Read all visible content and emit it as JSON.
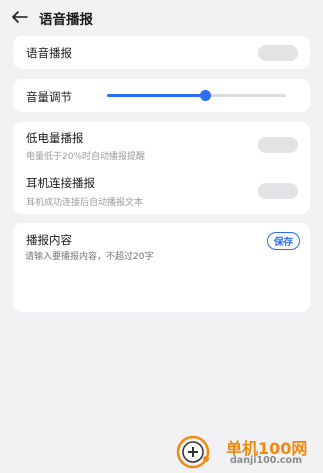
{
  "header": {
    "title": "语音播报"
  },
  "voice_broadcast": {
    "label": "语音播报",
    "enabled": false
  },
  "volume": {
    "label": "音量调节",
    "level": 0.55
  },
  "low_battery": {
    "label": "低电量播报",
    "description": "电量低于20%时自动播报提醒",
    "enabled": false
  },
  "earphone": {
    "label": "耳机连接播报",
    "description": "耳机成功连接后自动播报文本",
    "enabled": false
  },
  "broadcast_content": {
    "label": "播报内容",
    "save_label": "保存",
    "placeholder": "请输入要播报内容，不超过20字",
    "value": ""
  },
  "watermark": {
    "name": "单机100网",
    "url": "danji100.com"
  },
  "colors": {
    "accent": "#2a6ef2",
    "background": "#f2f2f4",
    "card": "#ffffff",
    "toggle_off": "#e3e3e6",
    "watermark": "#f08a0f"
  }
}
